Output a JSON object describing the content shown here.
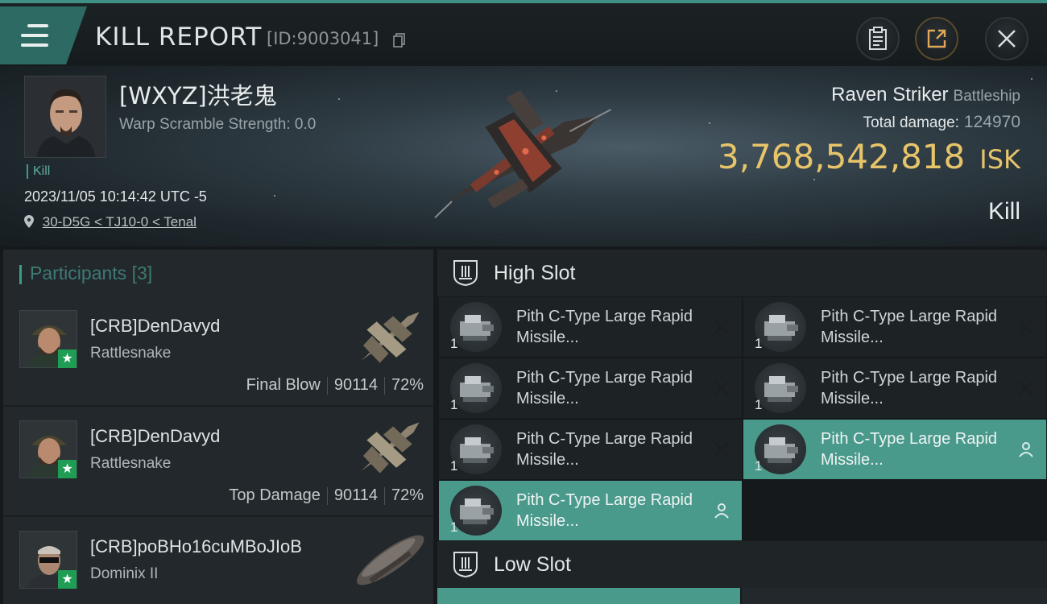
{
  "title": {
    "text": "KILL REPORT",
    "id": "[ID:9003041]"
  },
  "victim": {
    "name": "[WXYZ]洪老鬼",
    "warp_scramble": "Warp Scramble Strength: 0.0",
    "tag": "Kill",
    "time": "2023/11/05 10:14:42 UTC -5",
    "location": "30-D5G < TJ10-0 < Tenal"
  },
  "ship": {
    "name": "Raven Striker",
    "class": "Battleship",
    "total_damage_label": "Total damage:",
    "total_damage": "124970",
    "isk_value": "3,768,542,818",
    "isk_unit": "ISK",
    "result": "Kill"
  },
  "participants": {
    "label": "Participants",
    "count": "[3]",
    "items": [
      {
        "name": "[CRB]DenDavyd",
        "ship": "Rattlesnake",
        "role": "Final Blow",
        "damage": "90114",
        "percent": "72%"
      },
      {
        "name": "[CRB]DenDavyd",
        "ship": "Rattlesnake",
        "role": "Top Damage",
        "damage": "90114",
        "percent": "72%"
      },
      {
        "name": "[CRB]poBHo16cuMBoJIoB",
        "ship": "Dominix II"
      }
    ]
  },
  "high_slot": {
    "title": "High Slot",
    "modules": [
      {
        "qty": "1",
        "name": "Pith C-Type Large Rapid Missile...",
        "state": "destroyed"
      },
      {
        "qty": "1",
        "name": "Pith C-Type Large Rapid Missile...",
        "state": "destroyed"
      },
      {
        "qty": "1",
        "name": "Pith C-Type Large Rapid Missile...",
        "state": "destroyed"
      },
      {
        "qty": "1",
        "name": "Pith C-Type Large Rapid Missile...",
        "state": "destroyed"
      },
      {
        "qty": "1",
        "name": "Pith C-Type Large Rapid Missile...",
        "state": "destroyed"
      },
      {
        "qty": "1",
        "name": "Pith C-Type Large Rapid Missile...",
        "state": "dropped"
      },
      {
        "qty": "1",
        "name": "Pith C-Type Large Rapid Missile...",
        "state": "dropped"
      }
    ]
  },
  "low_slot": {
    "title": "Low Slot"
  },
  "colors": {
    "accent": "#3d9b8a",
    "active_module": "#4a9a8c",
    "isk_gold": "#e7c46a"
  },
  "icons": [
    "menu-icon",
    "copy-icon",
    "clipboard-icon",
    "share-icon",
    "close-icon",
    "location-pin-icon",
    "high-slot-icon",
    "low-slot-icon",
    "destroyed-x-icon",
    "dropped-person-icon",
    "star-badge-icon"
  ]
}
